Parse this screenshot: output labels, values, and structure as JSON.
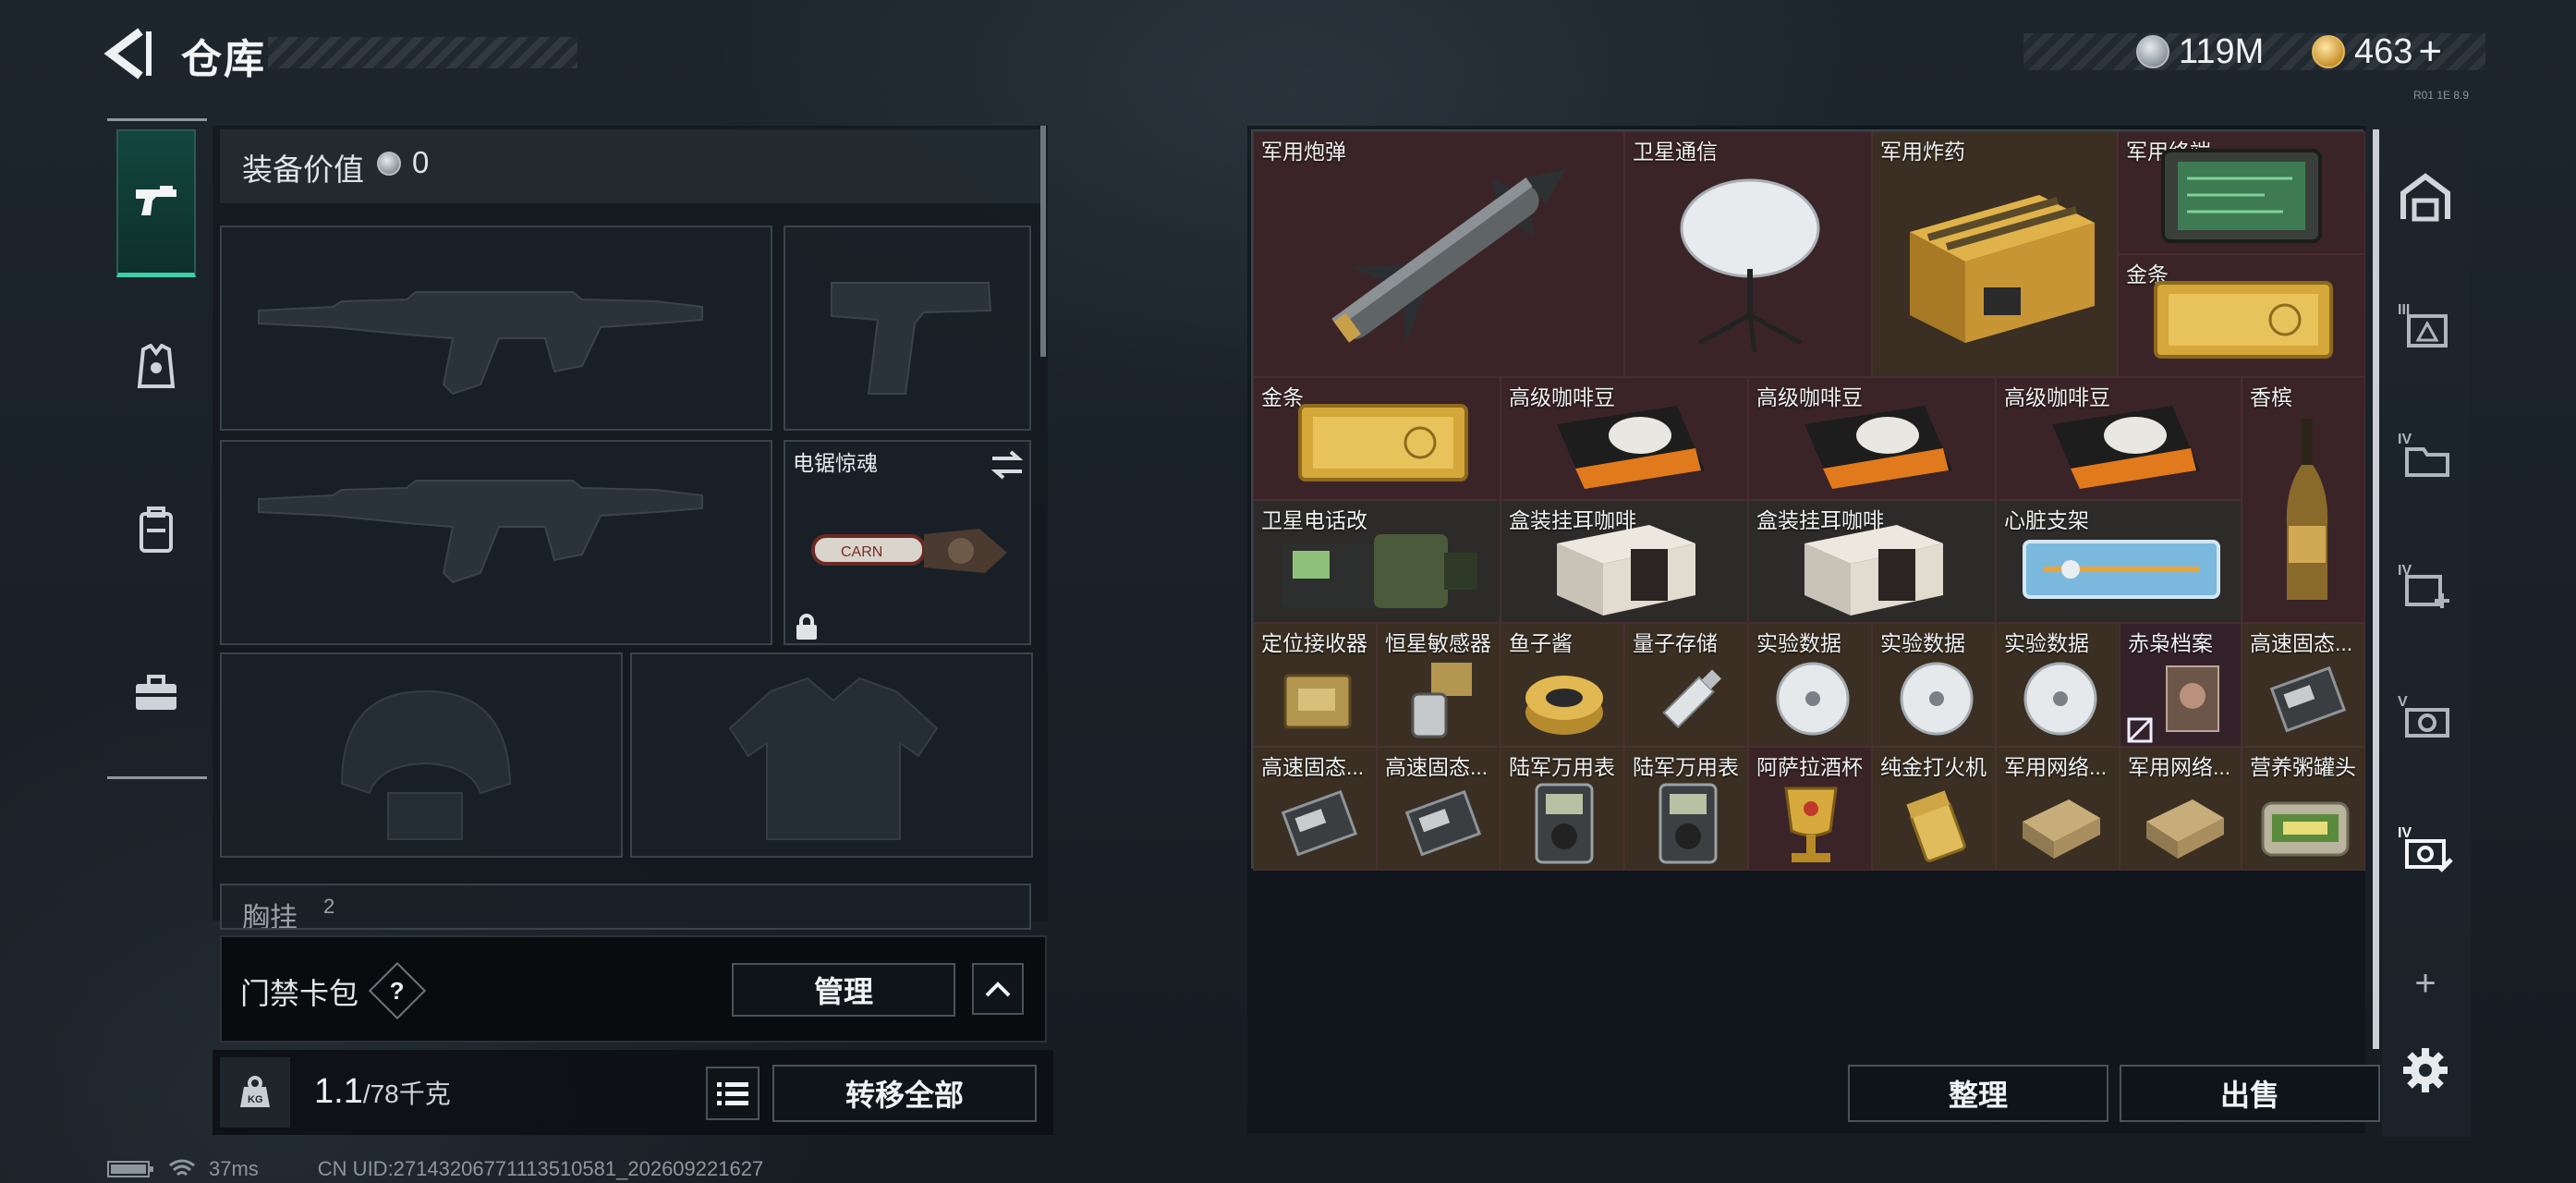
{
  "header": {
    "title": "仓库",
    "currency_silver": "119M",
    "currency_gold": "463",
    "currency_gold_add": "+",
    "corner_text": "R01 1E 8.9"
  },
  "loadout": {
    "equip_value_label": "装备价值",
    "equip_value": "0",
    "slots": {
      "secondary_weapon_label": "电锯惊魂",
      "chest_rig_label": "胸挂",
      "chest_rig_count": "2"
    }
  },
  "keycard": {
    "label": "门禁卡包",
    "help": "?",
    "manage_button": "管理"
  },
  "weight": {
    "current": "1.1",
    "max": "/78千克",
    "transfer_all_button": "转移全部"
  },
  "stash": {
    "items": [
      {
        "label": "军用炮弹"
      },
      {
        "label": "卫星通信"
      },
      {
        "label": "军用炸药"
      },
      {
        "label": "军用终端"
      },
      {
        "label": "金条"
      },
      {
        "label": "金条"
      },
      {
        "label": "高级咖啡豆"
      },
      {
        "label": "高级咖啡豆"
      },
      {
        "label": "高级咖啡豆"
      },
      {
        "label": "香槟"
      },
      {
        "label": "卫星电话改"
      },
      {
        "label": "盒装挂耳咖啡"
      },
      {
        "label": "盒装挂耳咖啡"
      },
      {
        "label": "心脏支架"
      },
      {
        "label": "定位接收器"
      },
      {
        "label": "恒星敏感器"
      },
      {
        "label": "鱼子酱"
      },
      {
        "label": "量子存储"
      },
      {
        "label": "实验数据"
      },
      {
        "label": "实验数据"
      },
      {
        "label": "实验数据"
      },
      {
        "label": "赤枭档案"
      },
      {
        "label": "高速固态..."
      },
      {
        "label": "高速固态..."
      },
      {
        "label": "高速固态..."
      },
      {
        "label": "陆军万用表"
      },
      {
        "label": "陆军万用表"
      },
      {
        "label": "阿萨拉酒杯"
      },
      {
        "label": "纯金打火机"
      },
      {
        "label": "军用网络..."
      },
      {
        "label": "军用网络..."
      },
      {
        "label": "营养粥罐头"
      }
    ],
    "sort_button": "整理",
    "sell_button": "出售"
  },
  "right_rail": {
    "add_tab": "+"
  },
  "footer": {
    "ping": "37ms",
    "uid": "CN UID:27143206771113510581_202609221627"
  },
  "colors": {
    "accent_green": "#3cd0a8",
    "cell_red": "#3b2428",
    "cell_gold": "#3a2f22"
  }
}
